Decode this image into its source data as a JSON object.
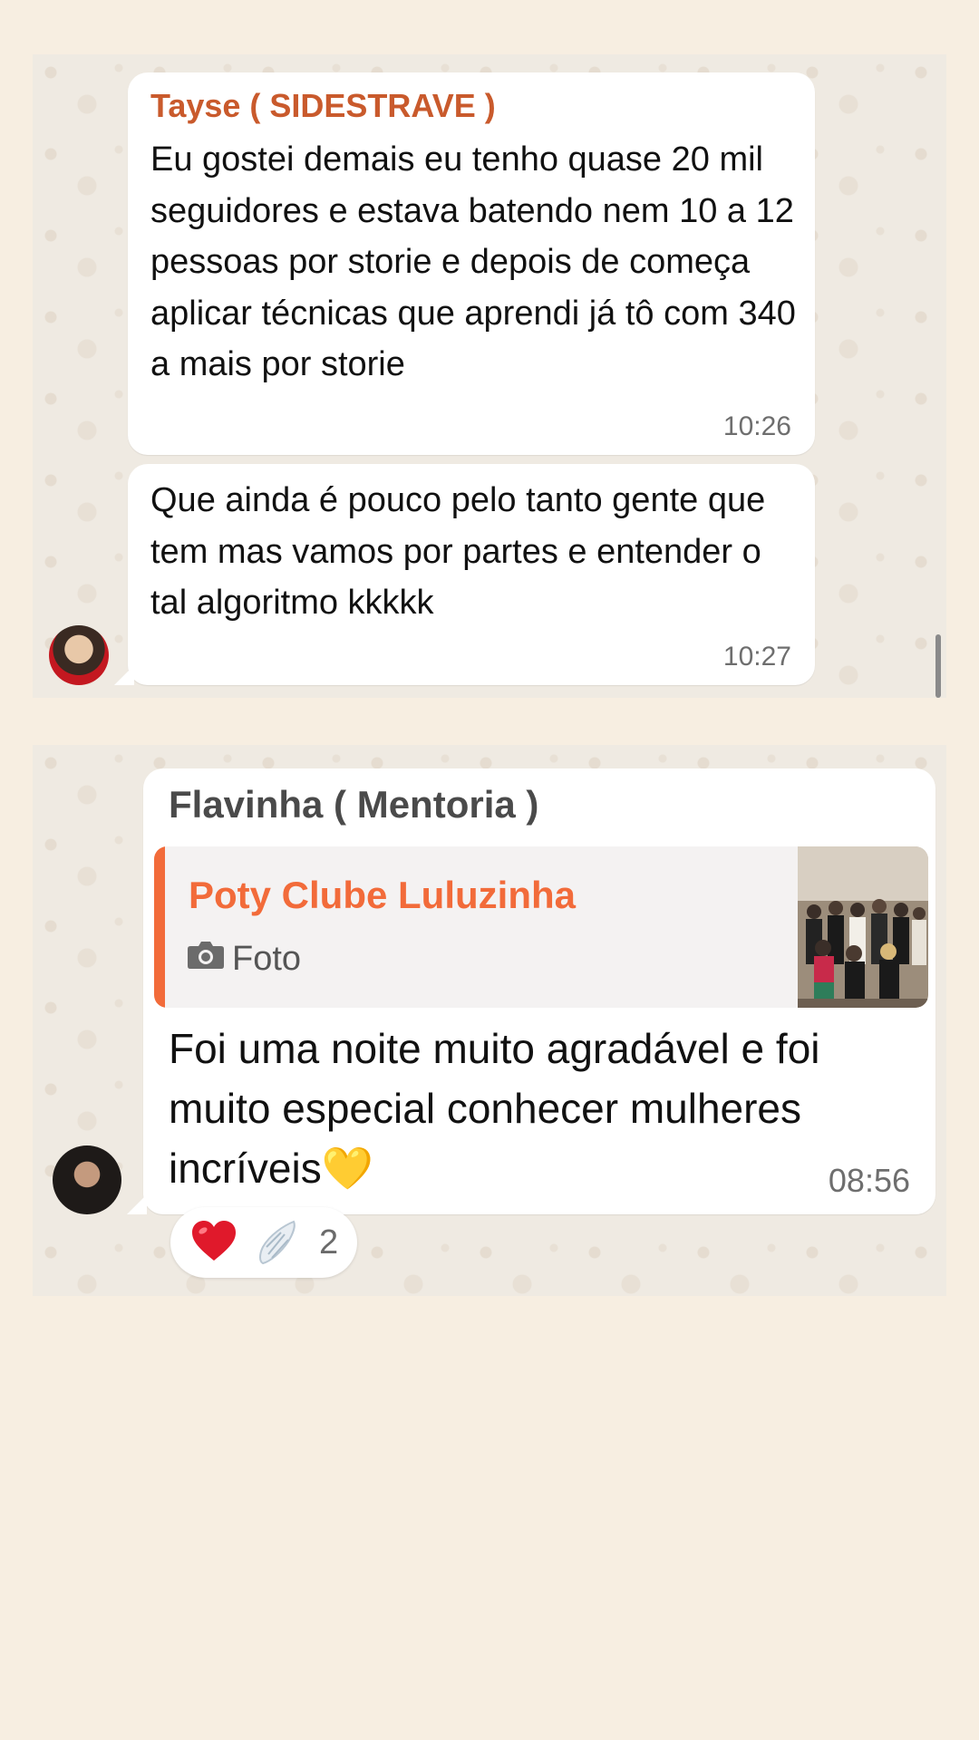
{
  "messages_top": [
    {
      "sender": "Tayse ( SIDESTRAVE )",
      "text": "Eu gostei demais eu tenho quase 20 mil seguidores e estava batendo nem 10 a 12 pessoas por storie e depois de começa aplicar técnicas que aprendi já tô com 340 a mais por storie",
      "time": "10:26"
    },
    {
      "text": "Que ainda é pouco pelo tanto gente que tem mas vamos por partes e entender o tal algoritmo kkkkk",
      "time": "10:27"
    }
  ],
  "message_bottom": {
    "sender": "Flavinha ( Mentoria )",
    "quote": {
      "author": "Poty Clube Luluzinha",
      "type_label": "Foto",
      "type_icon": "camera-icon"
    },
    "text": "Foi uma noite muito agradável e foi muito especial conhecer mulheres incríveis💛",
    "time": "08:56",
    "reactions": {
      "emojis": [
        "❤️",
        "🪽"
      ],
      "count": "2"
    }
  },
  "colors": {
    "page_bg": "#f7eee1",
    "chat_bg": "#efeae2",
    "sender_tayse": "#c95a2c",
    "quote_accent": "#f26b3a"
  }
}
